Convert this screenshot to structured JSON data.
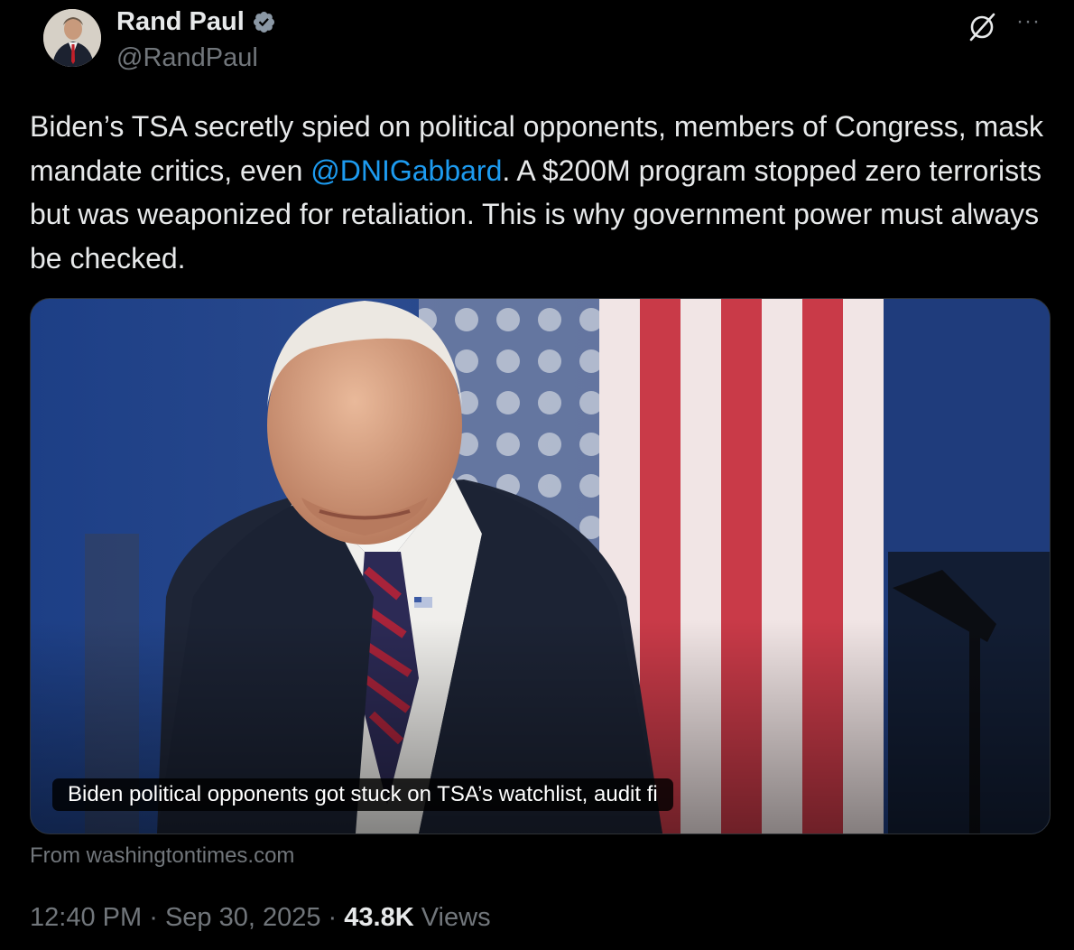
{
  "author": {
    "name": "Rand Paul",
    "handle": "@RandPaul",
    "verified": true,
    "avatar_alt": "Rand Paul profile photo"
  },
  "icons": {
    "verified": "verified-badge-icon",
    "grok": "grok-icon",
    "more": "more-options-icon"
  },
  "colors": {
    "background": "#000000",
    "text": "#e7e9ea",
    "muted": "#71767b",
    "link": "#1d9bf0",
    "border": "#2f3336"
  },
  "tweet": {
    "text_before_mention": "Biden’s TSA secretly spied on political opponents, members of Congress, mask mandate critics, even ",
    "mention": "@DNIGabbard",
    "text_after_mention": ". A $200M program stopped zero terrorists but was weaponized for retaliation. This is why government power must always be checked."
  },
  "card": {
    "caption": "Biden political opponents got stuck on TSA’s watchlist, audit fi",
    "source": "From washingtontimes.com"
  },
  "meta": {
    "time": "12:40 PM",
    "separator": "·",
    "date": "Sep 30, 2025",
    "views_count": "43.8K",
    "views_label": "Views"
  }
}
